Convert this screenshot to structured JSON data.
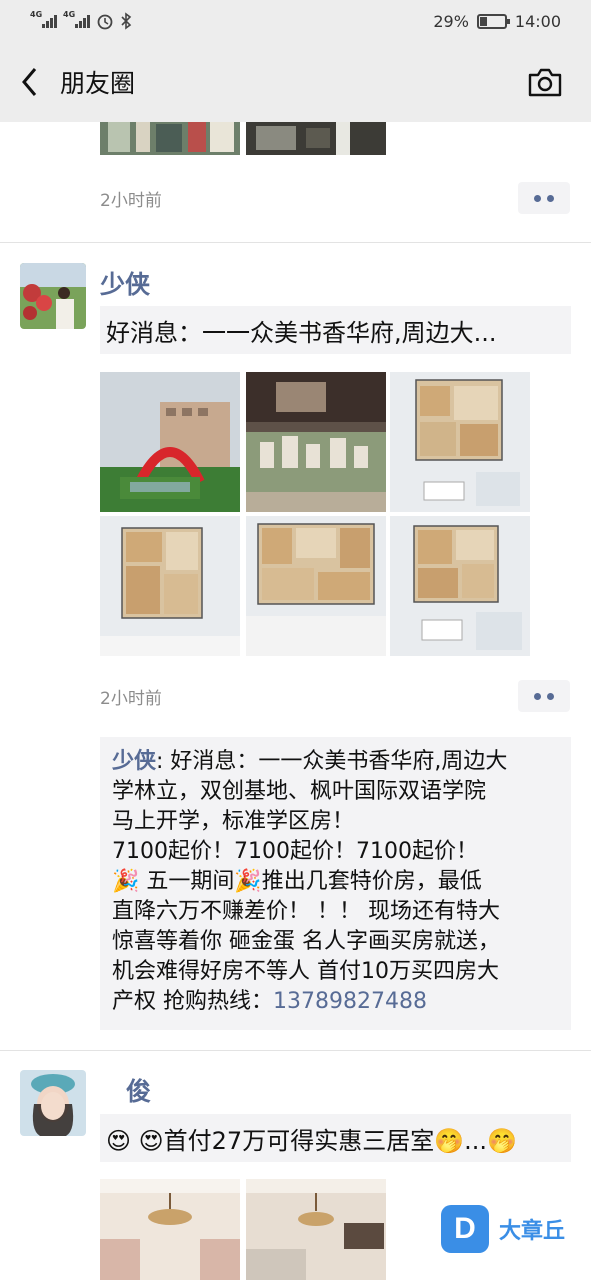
{
  "status_bar": {
    "network1": "4G",
    "network2": "4G",
    "battery": "29%",
    "battery_level": 0.29,
    "time": "14:00"
  },
  "nav": {
    "title": "朋友圈"
  },
  "posts": [
    {
      "time": "2小时前"
    },
    {
      "author": "少侠",
      "link_title": "好消息：一一众美书香华府,周边大...",
      "time": "2小时前",
      "comment_author": "少侠",
      "comment_sep": ": ",
      "comment_lines": [
        "好消息：一一众美书香华府,周边大",
        "学林立，双创基地、枫叶国际双语学院",
        "马上开学，标准学区房！",
        "7100起价！7100起价！7100起价！",
        "🎉 五一期间🎉推出几套特价房，最低",
        "直降六万不赚差价！ ！！ 现场还有特大",
        "惊喜等着你 砸金蛋 名人字画买房就送，",
        "机会难得好房不等人 首付10万买四房大"
      ],
      "comment_last": "产权  抢购热线：",
      "comment_phone": "13789827488"
    },
    {
      "author": "俊",
      "link_title": "😍 😍首付27万可得实惠三居室🤭...🤭"
    }
  ],
  "watermark": {
    "logo_letter": "D",
    "text": "大章丘"
  }
}
